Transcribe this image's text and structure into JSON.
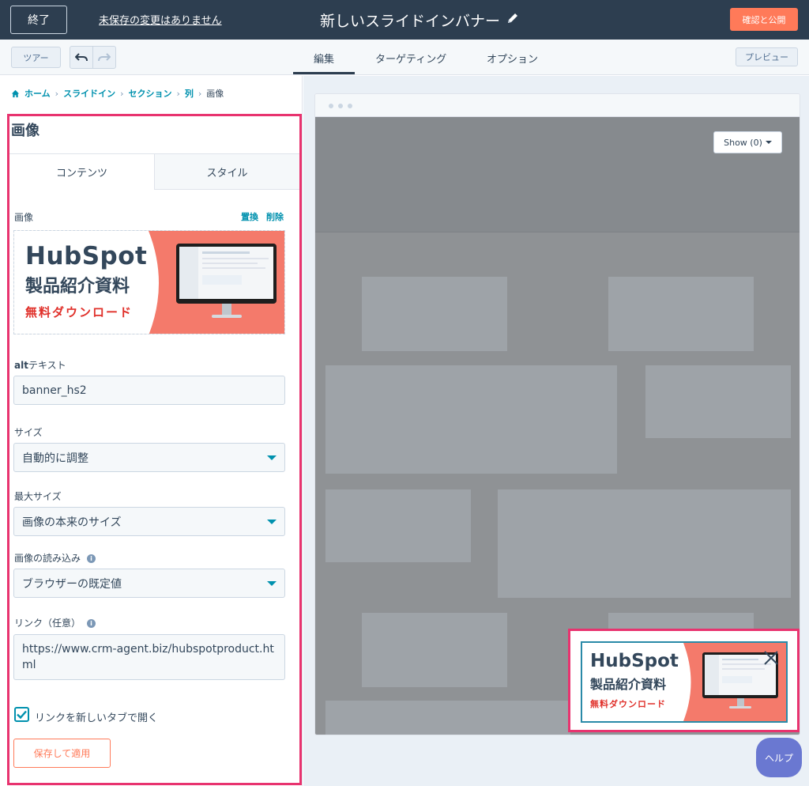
{
  "topbar": {
    "exit_label": "終了",
    "unsaved_label": "未保存の変更はありません",
    "title": "新しいスライドインバナー",
    "publish_label": "確認と公開"
  },
  "toolbar": {
    "tour_label": "ツアー",
    "tabs": [
      {
        "label": "編集",
        "active": true
      },
      {
        "label": "ターゲティング",
        "active": false
      },
      {
        "label": "オプション",
        "active": false
      }
    ],
    "preview_label": "プレビュー"
  },
  "breadcrumb": [
    "ホーム",
    "スライドイン",
    "セクション",
    "列",
    "画像"
  ],
  "panel": {
    "title": "画像",
    "subtabs": [
      "コンテンツ",
      "スタイル"
    ],
    "image_label": "画像",
    "image_replace": "置換",
    "image_delete": "削除",
    "alt_label_bold": "alt",
    "alt_label_rest": "テキスト",
    "alt_value": "banner_hs2",
    "size_label": "サイズ",
    "size_value": "自動的に調整",
    "max_size_label": "最大サイズ",
    "max_size_value": "画像の本来のサイズ",
    "loading_label": "画像の読み込み",
    "loading_value": "ブラウザーの既定値",
    "link_label": "リンク（任意）",
    "link_value": "https://www.crm-agent.biz/hubspotproduct.html",
    "new_tab_label": "リンクを新しいタブで開く",
    "new_tab_checked": true,
    "save_label": "保存して適用"
  },
  "banner": {
    "brand": "HubSpot",
    "subtitle": "製品紹介資料",
    "cta": "無料ダウンロード"
  },
  "preview": {
    "show_label": "Show (0)"
  },
  "help_label": "ヘルプ",
  "colors": {
    "topbar": "#2d3e50",
    "accent_orange": "#ff7a59",
    "link_teal": "#0091ae",
    "highlight_pink": "#e8336f",
    "banner_salmon": "#f47a6b",
    "help_purple": "#6a78d1"
  }
}
